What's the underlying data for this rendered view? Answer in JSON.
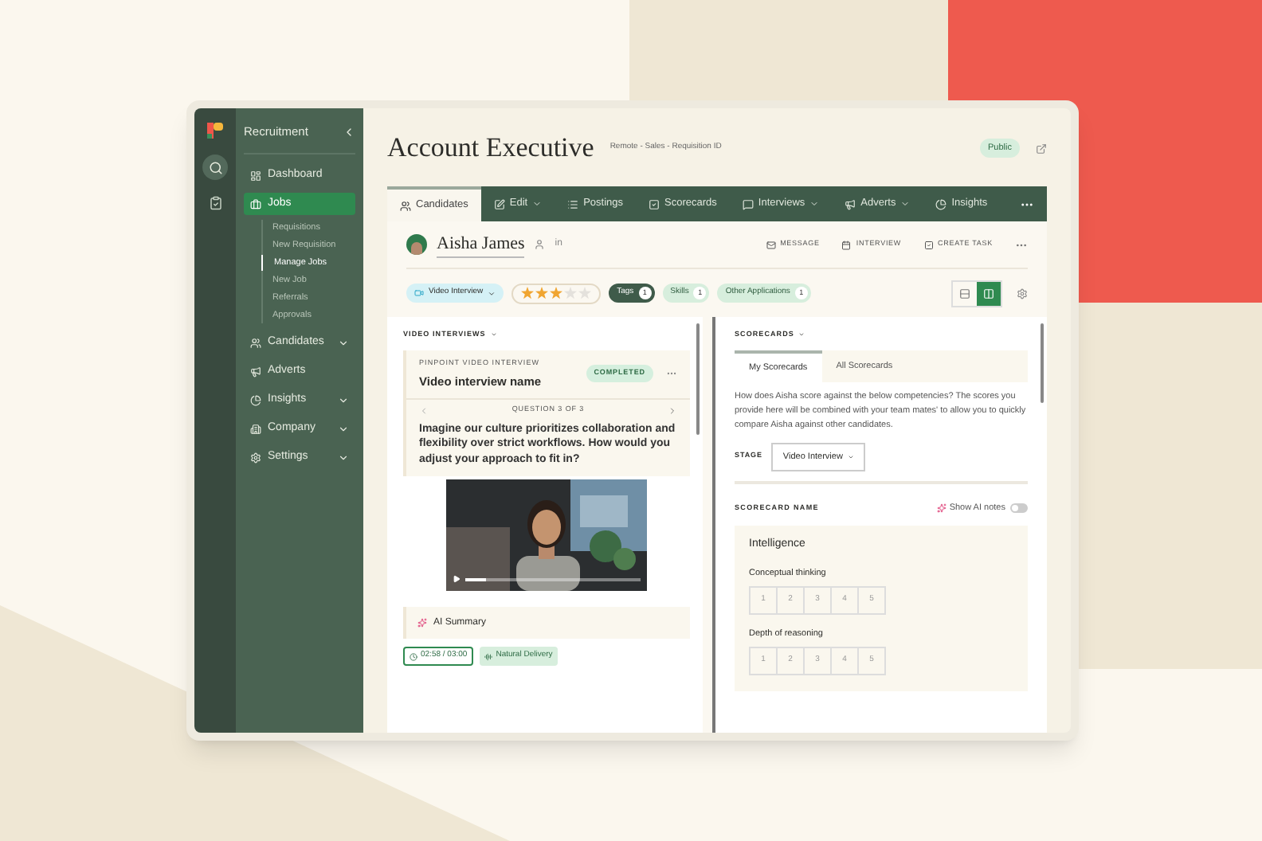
{
  "sidebar": {
    "title": "Recruitment",
    "items": [
      {
        "label": "Dashboard",
        "selected": false,
        "expandable": false
      },
      {
        "label": "Jobs",
        "selected": true,
        "expandable": false,
        "children": [
          {
            "label": "Requisitions",
            "selected": false
          },
          {
            "label": "New Requisition",
            "selected": false
          },
          {
            "label": "Manage Jobs",
            "selected": true
          },
          {
            "label": "New Job",
            "selected": false
          },
          {
            "label": "Referrals",
            "selected": false
          },
          {
            "label": "Approvals",
            "selected": false
          }
        ]
      },
      {
        "label": "Candidates",
        "selected": false,
        "expandable": true
      },
      {
        "label": "Adverts",
        "selected": false,
        "expandable": false
      },
      {
        "label": "Insights",
        "selected": false,
        "expandable": true
      },
      {
        "label": "Company",
        "selected": false,
        "expandable": true
      },
      {
        "label": "Settings",
        "selected": false,
        "expandable": true
      }
    ]
  },
  "job": {
    "title": "Account Executive",
    "meta": "Remote - Sales - Requisition ID",
    "visibility": "Public"
  },
  "tabs": [
    {
      "label": "Candidates",
      "selected": true,
      "dropdown": false
    },
    {
      "label": "Edit",
      "selected": false,
      "dropdown": true
    },
    {
      "label": "Postings",
      "selected": false,
      "dropdown": false
    },
    {
      "label": "Scorecards",
      "selected": false,
      "dropdown": false
    },
    {
      "label": "Interviews",
      "selected": false,
      "dropdown": true
    },
    {
      "label": "Adverts",
      "selected": false,
      "dropdown": true
    },
    {
      "label": "Insights",
      "selected": false,
      "dropdown": false
    }
  ],
  "candidate": {
    "name": "Aisha James",
    "linkedin": "in",
    "actions": [
      "MESSAGE",
      "INTERVIEW",
      "CREATE TASK"
    ]
  },
  "chips": [
    {
      "kind": "stage",
      "label": "Video Interview"
    },
    {
      "kind": "stars",
      "stars": 3
    },
    {
      "kind": "count",
      "label": "Tags",
      "count": "1",
      "selected": true
    },
    {
      "kind": "count",
      "label": "Skills",
      "count": "1",
      "selected": false
    },
    {
      "kind": "count",
      "label": "Other Applications",
      "count": "1",
      "selected": false
    }
  ],
  "views": [
    {
      "selected": false
    },
    {
      "selected": true
    }
  ],
  "video_panel": {
    "heading": "VIDEO INTERVIEWS",
    "eyebrow": "PINPOINT VIDEO INTERVIEW",
    "name": "Video interview name",
    "status": "COMPLETED",
    "question_nav": "QUESTION 3 OF 3",
    "question": "Imagine our culture prioritizes collaboration and flexibility over strict workflows. How would you adjust your approach to fit in?",
    "playback": {
      "level": 0.12
    },
    "summary": "AI Summary",
    "duration": "02:58 / 03:00",
    "trait": "Natural Delivery"
  },
  "scorecard_panel": {
    "heading": "SCORECARDS",
    "tabs": [
      {
        "label": "My Scorecards",
        "selected": true
      },
      {
        "label": "All Scorecards",
        "selected": false
      }
    ],
    "description": "How does Aisha score against the below competencies? The scores you provide here will be combined with your team mates' to allow you to quickly compare Aisha against other candidates.",
    "stage_label": "STAGE",
    "stage": "Video Interview",
    "scorecard_name": "SCORECARD NAME",
    "ai_notes": {
      "label": "Show AI notes",
      "on": false
    },
    "section": "Intelligence",
    "criteria": [
      {
        "label": "Conceptual thinking",
        "scale": [
          "1",
          "2",
          "3",
          "4",
          "5"
        ]
      },
      {
        "label": "Depth of reasoning",
        "scale": [
          "1",
          "2",
          "3",
          "4",
          "5"
        ]
      }
    ]
  }
}
